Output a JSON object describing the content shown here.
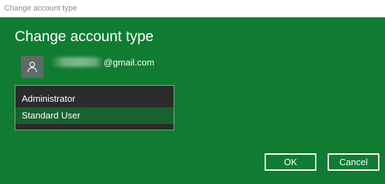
{
  "window": {
    "title": "Change account type"
  },
  "dialog": {
    "heading": "Change account type",
    "account": {
      "avatar_icon": "person-icon",
      "email_suffix": "@gmail.com"
    },
    "account_type_options": [
      {
        "label": "Administrator",
        "selected": false
      },
      {
        "label": "Standard User",
        "selected": true
      }
    ],
    "buttons": {
      "ok_label": "OK",
      "cancel_label": "Cancel"
    }
  },
  "colors": {
    "background": "#107c32",
    "dropdown_background": "#2b2b2b",
    "selected_option": "#1a6130",
    "avatar": "#5f6b66"
  }
}
